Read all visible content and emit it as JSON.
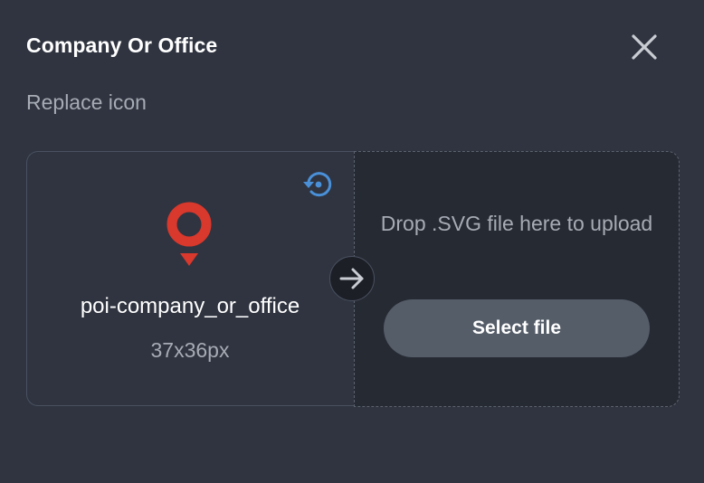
{
  "dialog": {
    "title": "Company Or Office",
    "subtitle": "Replace icon"
  },
  "current_icon": {
    "name": "poi-company_or_office",
    "dimensions": "37x36px",
    "icon": "location-pin-icon",
    "color": "#d9382c"
  },
  "upload": {
    "drop_text": "Drop .SVG file here to upload",
    "button_label": "Select file"
  },
  "icons": {
    "close": "close-icon",
    "reset": "reset-icon",
    "arrow": "arrow-right-icon"
  },
  "colors": {
    "background": "#2f3440",
    "drop_zone": "#262a33",
    "button": "#555d69",
    "accent_blue": "#4a90d9",
    "pin_red": "#d9382c"
  }
}
